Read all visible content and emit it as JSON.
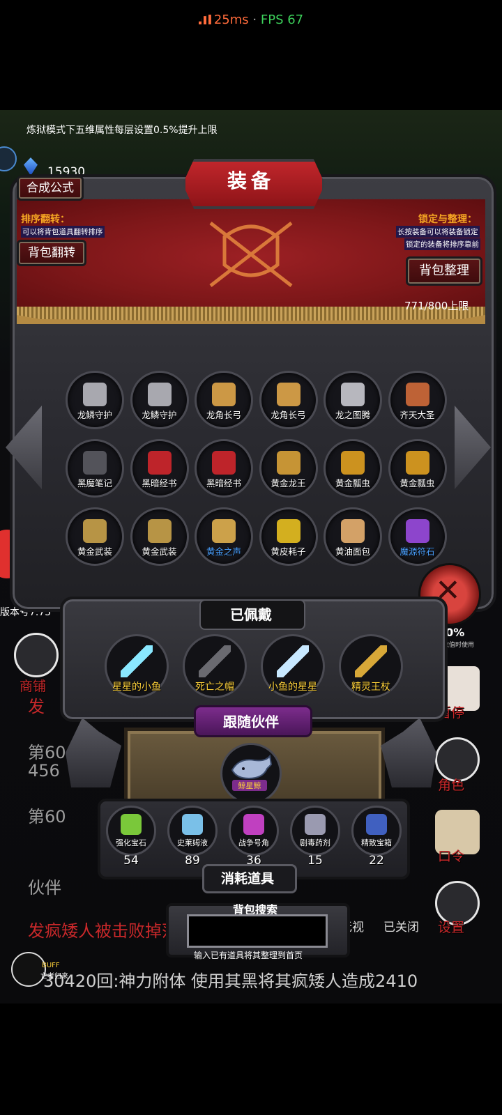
{
  "status_bar": {
    "latency": "25ms",
    "separator": " · ",
    "fps": "FPS 67"
  },
  "notice": "炼狱模式下五维属性每层设置0.5%提升上限",
  "currency": {
    "amount": "15930"
  },
  "panel": {
    "title": "装备",
    "synth_button": "合成公式",
    "sort_flip_title": "排序翻转：",
    "sort_flip_desc": "可以将背包道具翻转排序",
    "flip_button": "背包翻转",
    "lock_title": "锁定与整理：",
    "lock_desc1": "长按装备可以将装备锁定",
    "lock_desc2": "锁定的装备将排序靠前",
    "tidy_button": "背包整理",
    "capacity": "771/800上限"
  },
  "inventory": [
    {
      "label": "龙鳞守护",
      "icon": "shield-icon",
      "color": "#b8b8c0"
    },
    {
      "label": "龙鳞守护",
      "icon": "shield-icon",
      "color": "#b8b8c0"
    },
    {
      "label": "龙角长弓",
      "icon": "bow-icon",
      "color": "#e0a64a"
    },
    {
      "label": "龙角长弓",
      "icon": "bow-icon",
      "color": "#e0a64a"
    },
    {
      "label": "龙之图腾",
      "icon": "totem-icon",
      "color": "#c9c9d0"
    },
    {
      "label": "齐天大圣",
      "icon": "monkey-king-icon",
      "color": "#d06a3a"
    },
    {
      "label": "黑魔笔记",
      "icon": "book-icon",
      "color": "#5a5a62"
    },
    {
      "label": "黑暗经书",
      "icon": "red-book-icon",
      "color": "#d0262c"
    },
    {
      "label": "黑暗经书",
      "icon": "red-book-icon",
      "color": "#d0262c"
    },
    {
      "label": "黄金龙王",
      "icon": "dragon-icon",
      "color": "#d9a238"
    },
    {
      "label": "黄金瓢虫",
      "icon": "beetle-icon",
      "color": "#e0a020"
    },
    {
      "label": "黄金瓢虫",
      "icon": "beetle-icon",
      "color": "#e0a020"
    },
    {
      "label": "黄金武装",
      "icon": "armor-icon",
      "color": "#c9a24a"
    },
    {
      "label": "黄金武装",
      "icon": "armor-icon",
      "color": "#c9a24a"
    },
    {
      "label": "黄金之声",
      "icon": "harp-icon",
      "color": "#e0b050",
      "label_color": "#4aa0ff"
    },
    {
      "label": "黄皮耗子",
      "icon": "yellow-ball-icon",
      "color": "#e8c020"
    },
    {
      "label": "黄油面包",
      "icon": "bread-icon",
      "color": "#e8b070"
    },
    {
      "label": "魔源符石",
      "icon": "rune-stone-icon",
      "color": "#9a4ae0",
      "label_color": "#4aa0ff"
    }
  ],
  "left_overlay": {
    "version": "版本号7.75",
    "shop": "商铺"
  },
  "equipped": {
    "title": "已佩戴",
    "items": [
      {
        "label": "星星的小鱼",
        "icon": "sword-icon"
      },
      {
        "label": "死亡之帽",
        "icon": "hat-icon"
      },
      {
        "label": "小鱼的星星",
        "icon": "sparkle-sword-icon"
      },
      {
        "label": "精灵王杖",
        "icon": "staff-icon"
      }
    ]
  },
  "companion": {
    "title": "跟随伙伴",
    "pet_label": "鲸星鲸",
    "pet_icon": "whale-icon"
  },
  "consumables": {
    "title": "消耗道具",
    "items": [
      {
        "label": "强化宝石",
        "count": "54",
        "icon": "green-gem-icon",
        "color": "#7ac83a"
      },
      {
        "label": "史莱姆液",
        "count": "89",
        "icon": "potion-icon",
        "color": "#7ac0e8"
      },
      {
        "label": "战争号角",
        "count": "36",
        "icon": "horn-icon",
        "color": "#c040c0"
      },
      {
        "label": "剧毒药剂",
        "count": "15",
        "icon": "poison-icon",
        "color": "#9a9ab0"
      },
      {
        "label": "精致宝箱",
        "count": "22",
        "icon": "chest-icon",
        "color": "#4060c0"
      }
    ]
  },
  "search": {
    "title": "背包搜索",
    "hint": "输入已有道具将其整理到首页"
  },
  "right_menu": {
    "speed_value": "30%",
    "speed_note": "其数值时使用",
    "pause": "暂停",
    "role": "角色",
    "password": "口令",
    "settings": "设置",
    "closed": "已关闭",
    "watch": "无视"
  },
  "background_log": {
    "line1_prefix": "发",
    "line2": "第60",
    "line3": "456",
    "line4": "第60",
    "line5": "伙伴",
    "line6": "发疯矮人被击败掉落",
    "line7": "30420回:神力附体 使用其黑将其疯矮人造成2410",
    "buff_label": "BUFF",
    "buff_sub": "亡者归来"
  },
  "colors": {
    "accent_red": "#c8282a",
    "gold": "#ffd23a",
    "latency": "#ff6b3b",
    "fps": "#3ccf5a"
  }
}
